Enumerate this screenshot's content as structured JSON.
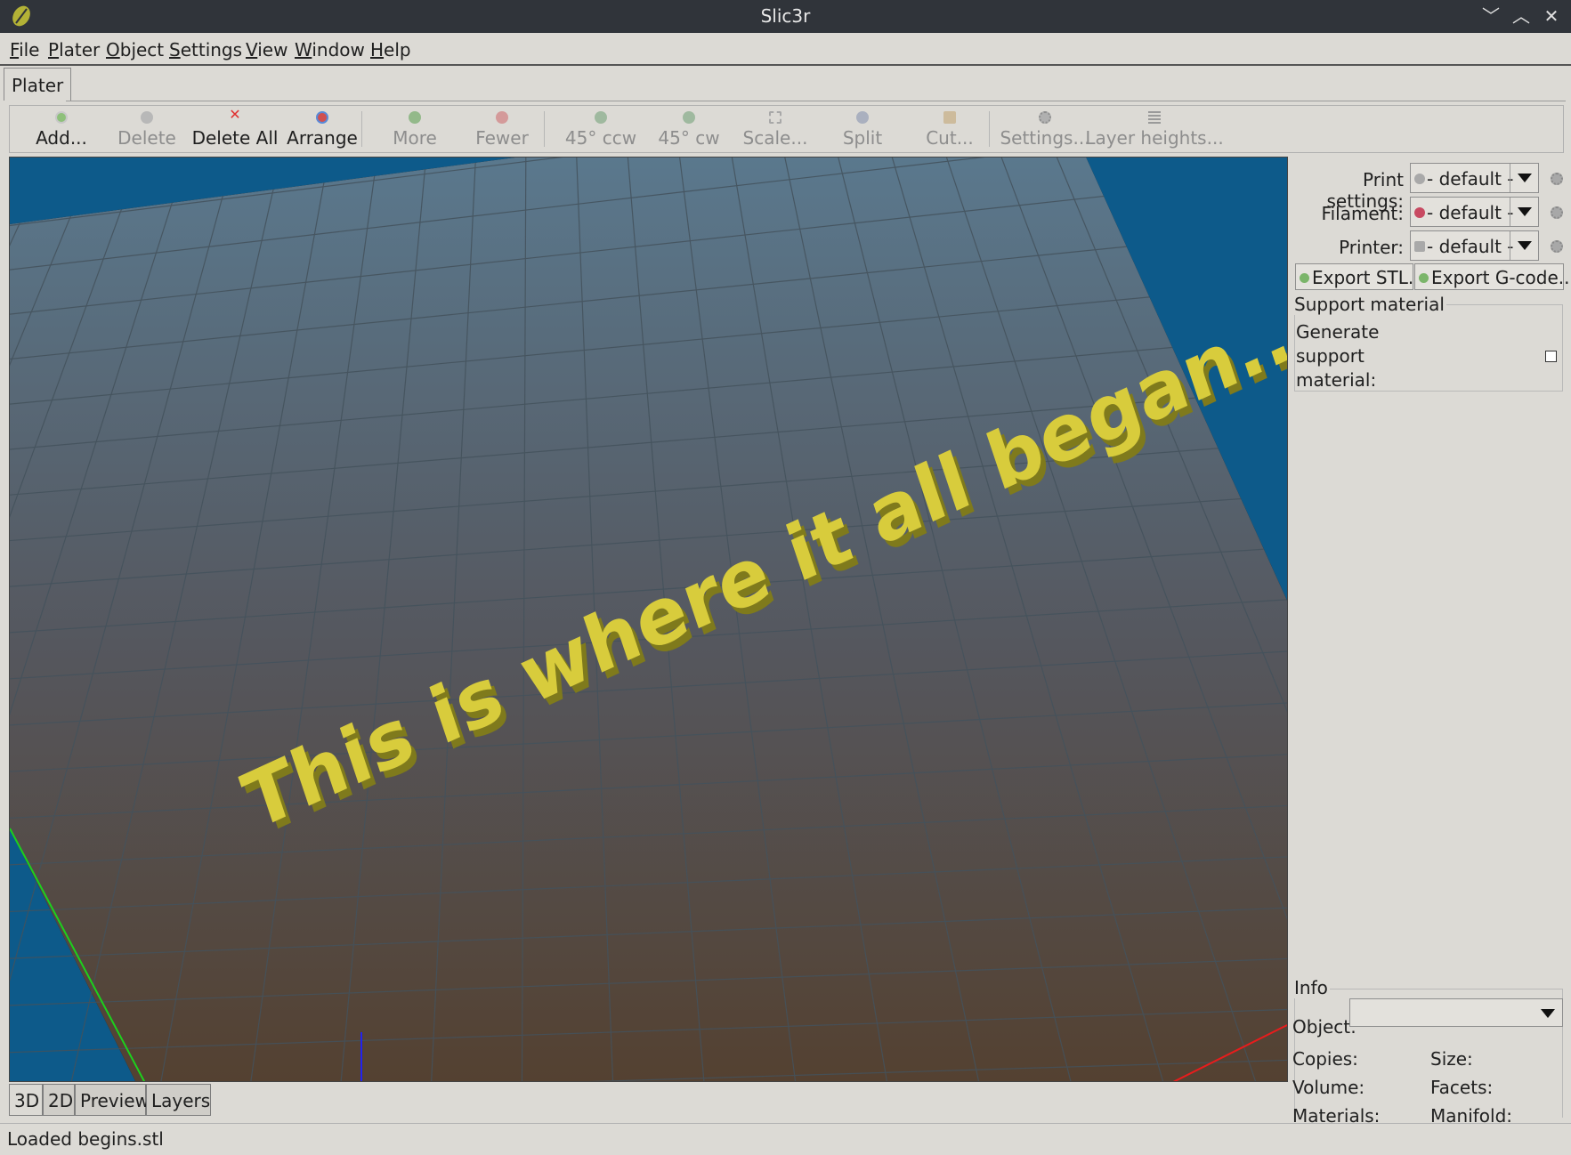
{
  "window": {
    "title": "Slic3r"
  },
  "menu": [
    "File",
    "Plater",
    "Object",
    "Settings",
    "View",
    "Window",
    "Help"
  ],
  "tabs": {
    "plater": "Plater"
  },
  "toolbar": {
    "add": "Add...",
    "delete": "Delete",
    "delete_all": "Delete All",
    "arrange": "Arrange",
    "more": "More",
    "fewer": "Fewer",
    "rotate_ccw": "45° ccw",
    "rotate_cw": "45° cw",
    "scale": "Scale...",
    "split": "Split",
    "cut": "Cut...",
    "settings": "Settings...",
    "layer_heights": "Layer heights..."
  },
  "viewport": {
    "model_text": "This is where it all began...",
    "model_color": "#d8cc3c",
    "bed_color_top": "#5b7d94",
    "bed_color_bottom": "#54402f",
    "background_color": "#0d5a8a"
  },
  "view_tabs": [
    "3D",
    "2D",
    "Preview",
    "Layers"
  ],
  "presets": {
    "print_label": "Print settings:",
    "print_value": "- default -",
    "filament_label": "Filament:",
    "filament_value": "- default -",
    "printer_label": "Printer:",
    "printer_value": "- default -"
  },
  "export": {
    "stl": "Export STL...",
    "gcode": "Export G-code..."
  },
  "support": {
    "title": "Support material",
    "generate_label": "Generate support material:",
    "generate_checked": false
  },
  "info": {
    "title": "Info",
    "object_label": "Object:",
    "object_value": "",
    "copies_label": "Copies:",
    "size_label": "Size:",
    "volume_label": "Volume:",
    "facets_label": "Facets:",
    "materials_label": "Materials:",
    "manifold_label": "Manifold:"
  },
  "status": {
    "text": "Loaded begins.stl"
  }
}
